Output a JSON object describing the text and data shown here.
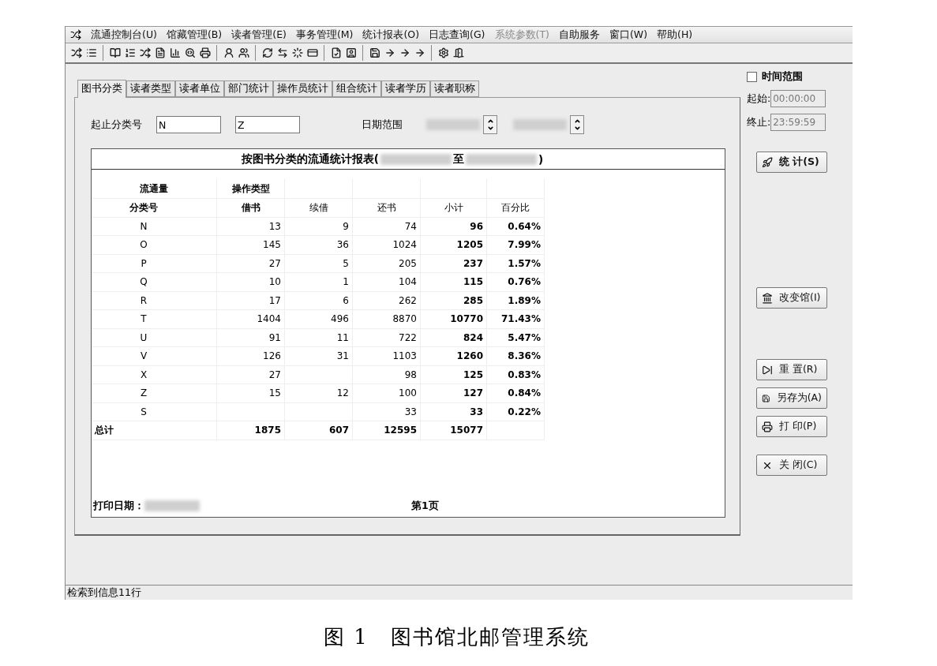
{
  "menu": [
    {
      "label": "流通控制台(U)",
      "disabled": false
    },
    {
      "label": "馆藏管理(B)",
      "disabled": false
    },
    {
      "label": "读者管理(E)",
      "disabled": false
    },
    {
      "label": "事务管理(M)",
      "disabled": false
    },
    {
      "label": "统计报表(O)",
      "disabled": false
    },
    {
      "label": "日志查询(G)",
      "disabled": false
    },
    {
      "label": "系统参数(T)",
      "disabled": true
    },
    {
      "label": "自助服务",
      "disabled": false
    },
    {
      "label": "窗口(W)",
      "disabled": false
    },
    {
      "label": "帮助(H)",
      "disabled": false
    }
  ],
  "tabs": [
    {
      "label": "图书分类",
      "selected": true
    },
    {
      "label": "读者类型",
      "selected": false
    },
    {
      "label": "读者单位",
      "selected": false
    },
    {
      "label": "部门统计",
      "selected": false
    },
    {
      "label": "操作员统计",
      "selected": false
    },
    {
      "label": "组合统计",
      "selected": false
    },
    {
      "label": "读者学历",
      "selected": false
    },
    {
      "label": "读者职称",
      "selected": false
    }
  ],
  "filter": {
    "class_label": "起止分类号",
    "class_from": "N",
    "class_to": "Z",
    "date_label": "日期范围"
  },
  "report": {
    "title_start": "按图书分类的流通统计报表(",
    "title_mid": "至",
    "title_end": ")",
    "header_1": [
      "流通量",
      "操作类型"
    ],
    "header_2": [
      "分类号",
      "借书",
      "续借",
      "还书",
      "小计",
      "百分比"
    ],
    "rows": [
      {
        "code": "N",
        "borrow": "13",
        "renew": "9",
        "return": "74",
        "subtotal": "96",
        "percent": "0.64%"
      },
      {
        "code": "O",
        "borrow": "145",
        "renew": "36",
        "return": "1024",
        "subtotal": "1205",
        "percent": "7.99%"
      },
      {
        "code": "P",
        "borrow": "27",
        "renew": "5",
        "return": "205",
        "subtotal": "237",
        "percent": "1.57%"
      },
      {
        "code": "Q",
        "borrow": "10",
        "renew": "1",
        "return": "104",
        "subtotal": "115",
        "percent": "0.76%"
      },
      {
        "code": "R",
        "borrow": "17",
        "renew": "6",
        "return": "262",
        "subtotal": "285",
        "percent": "1.89%"
      },
      {
        "code": "T",
        "borrow": "1404",
        "renew": "496",
        "return": "8870",
        "subtotal": "10770",
        "percent": "71.43%"
      },
      {
        "code": "U",
        "borrow": "91",
        "renew": "11",
        "return": "722",
        "subtotal": "824",
        "percent": "5.47%"
      },
      {
        "code": "V",
        "borrow": "126",
        "renew": "31",
        "return": "1103",
        "subtotal": "1260",
        "percent": "8.36%"
      },
      {
        "code": "X",
        "borrow": "27",
        "return": "98",
        "subtotal": "125",
        "percent": "0.83%"
      },
      {
        "code": "Z",
        "borrow": "15",
        "renew": "12",
        "return": "100",
        "subtotal": "127",
        "percent": "0.84%"
      },
      {
        "code": "S",
        "return": "33",
        "subtotal": "33",
        "percent": "0.22%"
      }
    ],
    "total": {
      "label": "总计",
      "borrow": "1875",
      "renew": "607",
      "return": "12595",
      "subtotal": "15077"
    },
    "print_date_label": "打印日期：",
    "page": "第1页"
  },
  "time_range": {
    "label": "时间范围",
    "checked": false,
    "start_label": "起始:",
    "start": "00:00:00",
    "end_label": "终止:",
    "end": "23:59:59"
  },
  "buttons": [
    {
      "label": "统 计(S)",
      "kind": "stats",
      "bold": true
    },
    {
      "label": "改变馆(I)",
      "kind": "library",
      "bold": false
    },
    {
      "label": "重 置(R)",
      "kind": "reset",
      "bold": false
    },
    {
      "label": "另存为(A)",
      "kind": "save",
      "bold": false
    },
    {
      "label": "打 印(P)",
      "kind": "print",
      "bold": false
    },
    {
      "label": "关 闭(C)",
      "kind": "close",
      "bold": false
    }
  ],
  "status_bar": "检索到信息11行",
  "caption": "图 1　图书馆北邮管理系统"
}
